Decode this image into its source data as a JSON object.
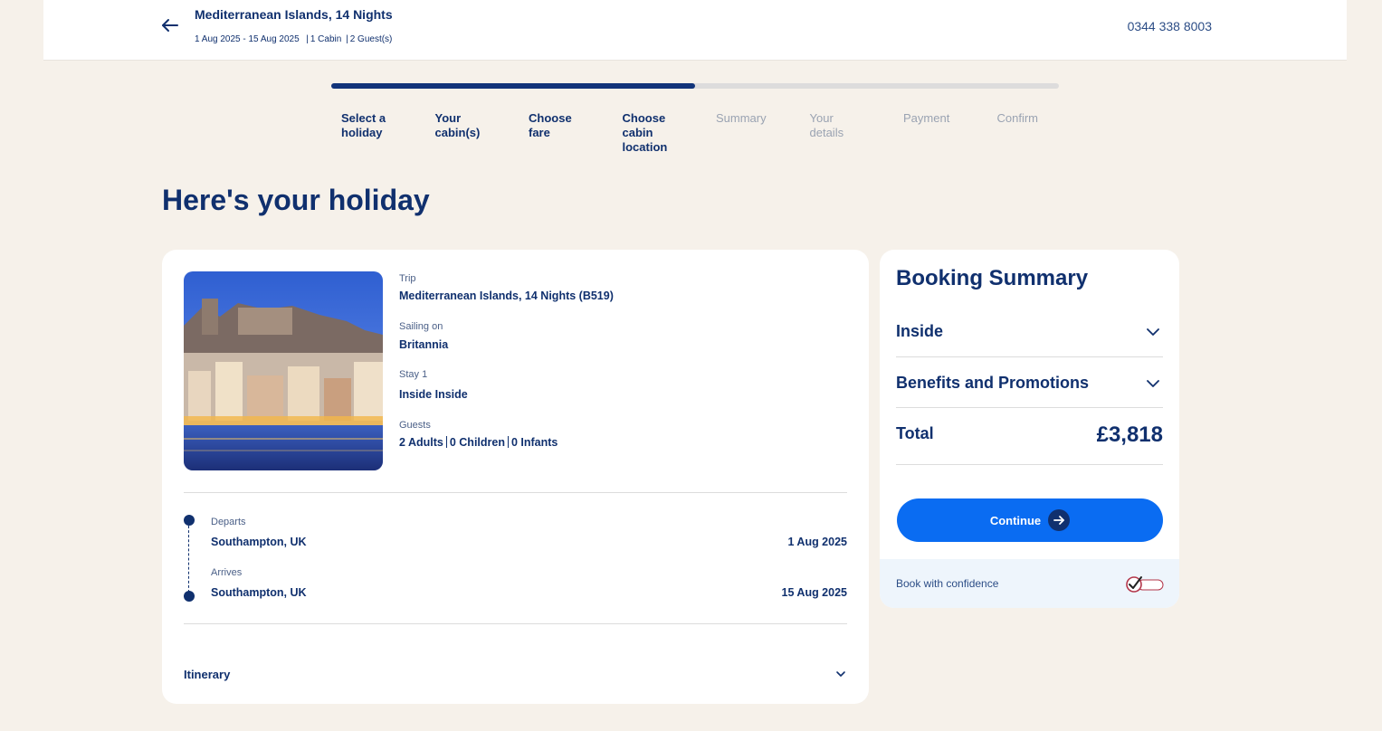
{
  "header": {
    "title": "Mediterranean Islands, 14 Nights",
    "dates": "1 Aug 2025 - 15 Aug 2025",
    "cabins": "1 Cabin",
    "guests": "2 Guest(s)",
    "phone": "0344 338 8003"
  },
  "progress": {
    "fraction": 0.5,
    "steps": [
      {
        "label": "Select a holiday",
        "line1": "Select a",
        "line2": "holiday",
        "line3": "",
        "active": true
      },
      {
        "label": "Your cabin(s)",
        "line1": "Your",
        "line2": "cabin(s)",
        "line3": "",
        "active": true
      },
      {
        "label": "Choose fare",
        "line1": "Choose",
        "line2": "fare",
        "line3": "",
        "active": true
      },
      {
        "label": "Choose cabin location",
        "line1": "Choose",
        "line2": "cabin",
        "line3": "location",
        "active": true
      },
      {
        "label": "Summary",
        "line1": "Summary",
        "line2": "",
        "line3": "",
        "active": false
      },
      {
        "label": "Your details",
        "line1": "Your",
        "line2": "details",
        "line3": "",
        "active": false
      },
      {
        "label": "Payment",
        "line1": "Payment",
        "line2": "",
        "line3": "",
        "active": false
      },
      {
        "label": "Confirm",
        "line1": "Confirm",
        "line2": "",
        "line3": "",
        "active": false
      }
    ]
  },
  "page_title": "Here's your holiday",
  "holiday": {
    "trip_label": "Trip",
    "trip_value": "Mediterranean Islands, 14 Nights (B519)",
    "sailing_label": "Sailing on",
    "sailing_value": "Britannia",
    "stay_label": "Stay 1",
    "stay_value": "Inside Inside",
    "guests_label": "Guests",
    "adults": "2 Adults",
    "children": "0 Children",
    "infants": "0 Infants",
    "departs_label": "Departs",
    "departs_port": "Southampton, UK",
    "departs_date": "1 Aug 2025",
    "arrives_label": "Arrives",
    "arrives_port": "Southampton, UK",
    "arrives_date": "15 Aug 2025",
    "itinerary_label": "Itinerary"
  },
  "summary": {
    "title": "Booking Summary",
    "cabin_label": "Inside",
    "benefits_label": "Benefits and Promotions",
    "total_label": "Total",
    "total_value": "£3,818",
    "continue_label": "Continue",
    "confidence_label": "Book with confidence"
  },
  "colors": {
    "navy": "#10306e",
    "primary_button": "#0a6cf2",
    "background": "#f6f1ea",
    "inactive_step": "#9aa3b2"
  },
  "icons": {
    "back": "arrow-left-icon",
    "chevron": "chevron-down-icon",
    "continue": "arrow-right-circle-icon",
    "confidence": "abta-check-logo"
  }
}
